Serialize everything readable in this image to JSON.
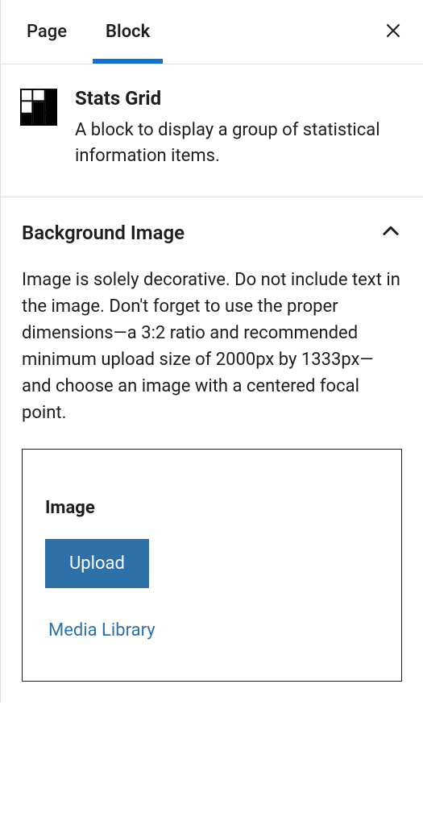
{
  "tabs": {
    "page": "Page",
    "block": "Block"
  },
  "block": {
    "title": "Stats Grid",
    "description": "A block to display a group of statistical information items."
  },
  "section": {
    "title": "Background Image",
    "help": "Image is solely decorative. Do not include text in the image. Don't forget to use the proper dimensions—a 3:2 ratio and recommended minimum upload size of 2000px by 1333px—and choose an image with a centered focal point."
  },
  "media": {
    "label": "Image",
    "upload": "Upload",
    "library": "Media Library"
  }
}
